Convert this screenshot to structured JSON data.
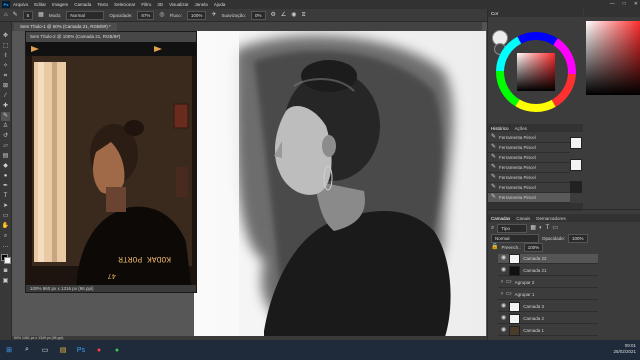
{
  "app": {
    "logo": "Ps",
    "window_controls": [
      "—",
      "□",
      "✕"
    ]
  },
  "menu": [
    "Arquivo",
    "Editar",
    "Imagem",
    "Camada",
    "Texto",
    "Selecionar",
    "Filtro",
    "3D",
    "Visualizar",
    "Janela",
    "Ajuda"
  ],
  "options_bar": {
    "size": "5",
    "mode_label": "Modo:",
    "mode_value": "Normal",
    "opacity_label": "Opacidade:",
    "opacity_value": "87%",
    "flow_label": "Fluxo:",
    "flow_value": "100%",
    "smoothing_label": "Suavização:",
    "smoothing_value": "0%"
  },
  "document_tab": "Sem Título-1 @ 50% (Camada 21, RGB/8#) *",
  "reference_window": {
    "title": "Sem Título-2 @ 100% (Camada 21, RGB/8#)",
    "status": "100%    860 px x 1316 px (96 ppi)",
    "film_text": "KODAK PORTR",
    "frame_number": "47"
  },
  "statusbar": "50%    1461 px x 1349 px (96 ppi)",
  "color_panel": {
    "title": "Cor",
    "accent_colors": [
      "#ff3030",
      "#ffff00",
      "#00ff00",
      "#00ffff",
      "#0000ff",
      "#ff00ff"
    ]
  },
  "history_panel": {
    "tabs": [
      "Histórico",
      "Ações"
    ],
    "items": [
      "Ferramenta Pincel",
      "Ferramenta Pincel",
      "Ferramenta Pincel",
      "Ferramenta Pincel",
      "Ferramenta Pincel",
      "Ferramenta Pincel",
      "Ferramenta Pincel",
      "Ferramenta Pincel"
    ]
  },
  "layers_panel": {
    "tabs": [
      "Camadas",
      "Canais",
      "Demarcadores"
    ],
    "kind": "Tipo",
    "blend": "Normal",
    "opacity_label": "Opacidade:",
    "opacity_value": "100%",
    "fill_label": "Preench.:",
    "fill_value": "100%",
    "layers": [
      {
        "name": "Camada 22",
        "thumb": "#f3f3f3"
      },
      {
        "name": "Camada 21",
        "thumb": "#111111"
      },
      {
        "name": "Agrupar 2",
        "thumb": "folder"
      },
      {
        "name": "Agrupar 1",
        "thumb": "folder"
      },
      {
        "name": "Camada 3",
        "thumb": "#f3f3f3"
      },
      {
        "name": "Camada 2",
        "thumb": "#f3f3f3"
      },
      {
        "name": "Camada 1",
        "thumb": "#4a3b2a"
      }
    ]
  },
  "taskbar": {
    "time": "09:01",
    "date": "25/02/2021"
  }
}
